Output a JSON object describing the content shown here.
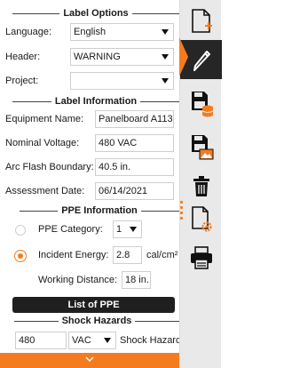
{
  "label_options": {
    "title": "Label Options",
    "language_label": "Language:",
    "language_value": "English",
    "header_label": "Header:",
    "header_value": "WARNING",
    "project_label": "Project:",
    "project_value": ""
  },
  "label_information": {
    "title": "Label Information",
    "equipment_name_label": "Equipment Name:",
    "equipment_name_value": "Panelboard A113",
    "nominal_voltage_label": "Nominal Voltage:",
    "nominal_voltage_value": "480 VAC",
    "arc_flash_boundary_label": "Arc Flash Boundary:",
    "arc_flash_boundary_value": "40.5 in.",
    "assessment_date_label": "Assessment Date:",
    "assessment_date_value": "06/14/2021"
  },
  "ppe_information": {
    "title": "PPE Information",
    "ppe_category_label": "PPE Category:",
    "ppe_category_value": "1",
    "incident_energy_label": "Incident Energy:",
    "incident_energy_value": "2.8",
    "incident_energy_unit": "cal/cm²",
    "working_distance_label": "Working Distance:",
    "working_distance_value": "18 in.",
    "list_button": "List of PPE"
  },
  "shock_hazards": {
    "title": "Shock Hazards",
    "voltage_value": "480",
    "unit_value": "VAC",
    "type_label": "Shock Hazard"
  },
  "colors": {
    "accent": "#f47c1f",
    "dark": "#1f1f1f",
    "sidebar_bg": "#e9e9e9"
  },
  "sidebar": {
    "items": [
      "add-label-icon",
      "edit-pencil-icon",
      "save-database-icon",
      "save-image-icon",
      "delete-trash-icon",
      "document-settings-icon",
      "print-icon"
    ]
  }
}
